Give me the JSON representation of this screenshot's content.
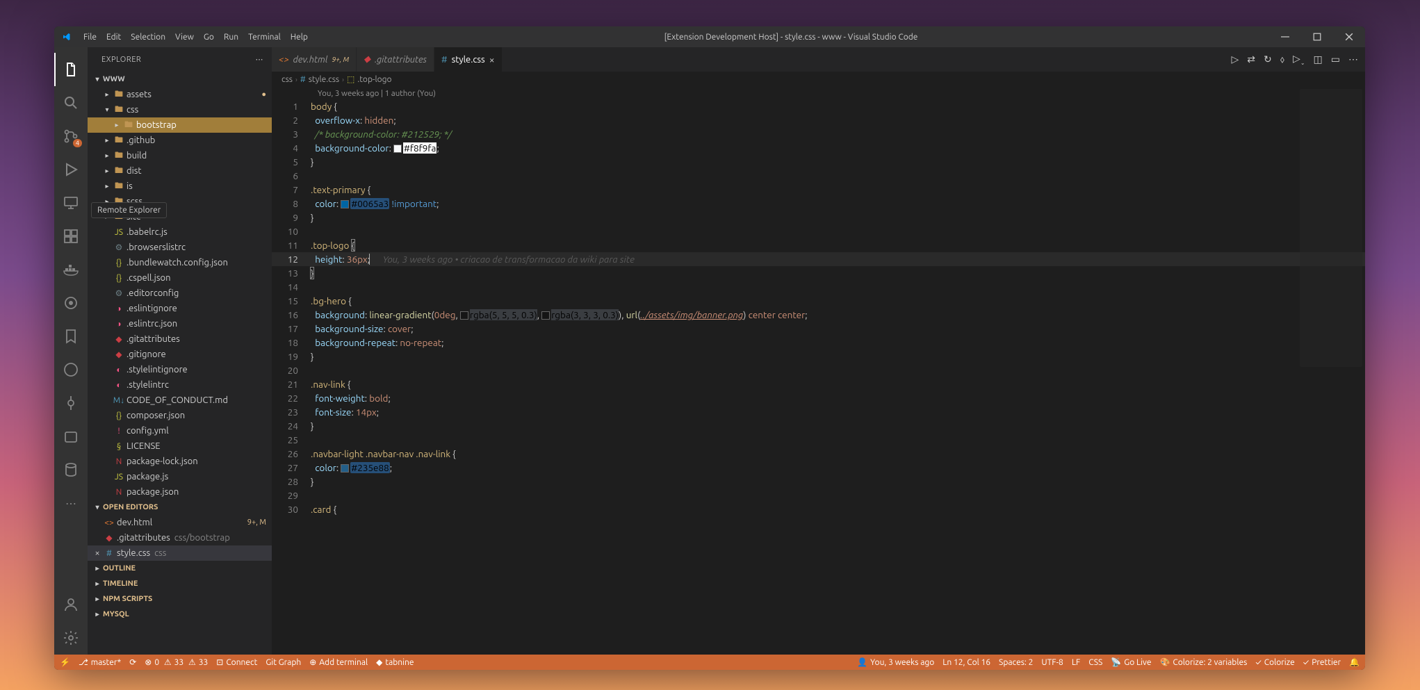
{
  "window": {
    "title": "[Extension Development Host] - style.css - www - Visual Studio Code",
    "menu": [
      "File",
      "Edit",
      "Selection",
      "View",
      "Go",
      "Run",
      "Terminal",
      "Help"
    ]
  },
  "activitybar": {
    "source_control_badge": "4",
    "tooltip": "Remote Explorer"
  },
  "sidebar": {
    "title": "EXPLORER",
    "root": "WWW",
    "tree": [
      {
        "indent": 1,
        "type": "folder",
        "icon": "folder",
        "label": "assets",
        "dot": true
      },
      {
        "indent": 1,
        "type": "folder-open",
        "icon": "folder",
        "label": "css"
      },
      {
        "indent": 2,
        "type": "folder",
        "icon": "folder",
        "label": "bootstrap",
        "highlighted": true
      },
      {
        "indent": 1,
        "type": "folder",
        "icon": "folder",
        "label": ".github"
      },
      {
        "indent": 1,
        "type": "folder",
        "icon": "folder",
        "label": "build"
      },
      {
        "indent": 1,
        "type": "folder",
        "icon": "folder",
        "label": "dist"
      },
      {
        "indent": 1,
        "type": "folder",
        "icon": "folder",
        "label": "is"
      },
      {
        "indent": 1,
        "type": "folder",
        "icon": "folder",
        "label": "scss"
      },
      {
        "indent": 1,
        "type": "folder",
        "icon": "folder",
        "label": "site"
      },
      {
        "indent": 1,
        "type": "file",
        "icon": "js",
        "iconClass": "file-yellow",
        "label": ".babelrc.js"
      },
      {
        "indent": 1,
        "type": "file",
        "icon": "cfg",
        "iconClass": "file-gray",
        "label": ".browserslistrc"
      },
      {
        "indent": 1,
        "type": "file",
        "icon": "json",
        "iconClass": "file-yellow",
        "label": ".bundlewatch.config.json"
      },
      {
        "indent": 1,
        "type": "file",
        "icon": "json",
        "iconClass": "file-yellow",
        "label": ".cspell.json"
      },
      {
        "indent": 1,
        "type": "file",
        "icon": "cfg",
        "iconClass": "file-gray",
        "label": ".editorconfig"
      },
      {
        "indent": 1,
        "type": "file",
        "icon": "eslint",
        "iconClass": "file-pink",
        "label": ".eslintignore"
      },
      {
        "indent": 1,
        "type": "file",
        "icon": "eslint",
        "iconClass": "file-pink",
        "label": ".eslintrc.json"
      },
      {
        "indent": 1,
        "type": "file",
        "icon": "git",
        "iconClass": "file-red",
        "label": ".gitattributes"
      },
      {
        "indent": 1,
        "type": "file",
        "icon": "git",
        "iconClass": "file-red",
        "label": ".gitignore"
      },
      {
        "indent": 1,
        "type": "file",
        "icon": "stylelint",
        "iconClass": "file-pink",
        "label": ".stylelintignore"
      },
      {
        "indent": 1,
        "type": "file",
        "icon": "stylelint",
        "iconClass": "file-pink",
        "label": ".stylelintrc"
      },
      {
        "indent": 1,
        "type": "file",
        "icon": "md",
        "iconClass": "file-blue",
        "label": "CODE_OF_CONDUCT.md"
      },
      {
        "indent": 1,
        "type": "file",
        "icon": "json",
        "iconClass": "file-yellow",
        "label": "composer.json"
      },
      {
        "indent": 1,
        "type": "file",
        "icon": "yml",
        "iconClass": "file-pink",
        "label": "config.yml"
      },
      {
        "indent": 1,
        "type": "file",
        "icon": "lic",
        "iconClass": "file-yellow",
        "label": "LICENSE"
      },
      {
        "indent": 1,
        "type": "file",
        "icon": "npm",
        "iconClass": "file-red",
        "label": "package-lock.json"
      },
      {
        "indent": 1,
        "type": "file",
        "icon": "js",
        "iconClass": "file-yellow",
        "label": "package.js"
      },
      {
        "indent": 1,
        "type": "file",
        "icon": "npm",
        "iconClass": "file-red",
        "label": "package.json"
      }
    ],
    "open_editors_label": "OPEN EDITORS",
    "open_editors": [
      {
        "icon": "html",
        "iconClass": "file-orange",
        "label": "dev.html",
        "meta": "9+, M"
      },
      {
        "icon": "git",
        "iconClass": "file-red",
        "label": ".gitattributes",
        "meta_dim": "css/bootstrap"
      },
      {
        "icon": "css",
        "iconClass": "file-blue",
        "label": "style.css",
        "meta_dim": "css",
        "selected": true,
        "close": true
      }
    ],
    "sections": [
      "OUTLINE",
      "TIMELINE",
      "NPM SCRIPTS",
      "MYSQL"
    ]
  },
  "tabs": [
    {
      "icon": "html",
      "iconClass": "file-orange",
      "label": "dev.html",
      "gitBadge": "9+, M"
    },
    {
      "icon": "git",
      "iconClass": "file-red",
      "label": ".gitattributes",
      "italic": true
    },
    {
      "icon": "css",
      "iconClass": "file-blue",
      "label": "style.css",
      "active": true
    }
  ],
  "breadcrumb": [
    "css",
    "style.css",
    ".top-logo"
  ],
  "codelens": "You, 3 weeks ago | 1 author (You)",
  "code": {
    "blame": "You, 3 weeks ago • criacao de transformacao da wiki para site",
    "hexWhite": "#f8f9fa",
    "hexBlue": "#0065a3",
    "hexNav": "#235e88",
    "urlPath": "../assets/img/banner.png"
  },
  "statusbar": {
    "branch": "master*",
    "errors": "0",
    "warn": "33",
    "warn2": "33",
    "connect": "Connect",
    "gitgraph": "Git Graph",
    "addterm": "Add terminal",
    "tabnine": "tabnine",
    "blame": "You, 3 weeks ago",
    "pos": "Ln 12, Col 16",
    "spaces": "Spaces: 2",
    "enc": "UTF-8",
    "eol": "LF",
    "lang": "CSS",
    "golive": "Go Live",
    "colorize": "Colorize: 2 variables",
    "colorize2": "Colorize",
    "prettier": "Prettier"
  }
}
